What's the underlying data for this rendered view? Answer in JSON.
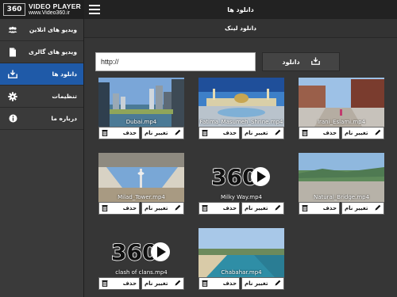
{
  "brand": {
    "logo": "360",
    "title": "VIDEO PLAYER",
    "url": "www.Video360.ir"
  },
  "sidebar": {
    "items": [
      {
        "label": "ویدیو های انلاین",
        "icon": "users-icon",
        "active": false
      },
      {
        "label": "ویدیو های گالری",
        "icon": "file-icon",
        "active": false
      },
      {
        "label": "دانلود ها",
        "icon": "download-tray-icon",
        "active": true
      },
      {
        "label": "تنظیمات",
        "icon": "gear-icon",
        "active": false
      },
      {
        "label": "درباره ما",
        "icon": "info-icon",
        "active": false
      }
    ]
  },
  "header": {
    "title": "دانلود ها",
    "menu_icon": "hamburger-icon"
  },
  "subheader": {
    "title": "دانلود لینک"
  },
  "download": {
    "url_value": "http://",
    "button_label": "دانلود",
    "button_icon": "download-tray-icon"
  },
  "actions": {
    "delete_label": "حذف",
    "rename_label": "تغییر نام",
    "delete_icon": "trash-icon",
    "rename_icon": "pencil-icon"
  },
  "videos": [
    {
      "filename": "Dubai.mp4",
      "thumb": "dubai"
    },
    {
      "filename": "Fatima_Masumeh_Shrine.mp4",
      "thumb": "shrine"
    },
    {
      "filename": "Irani_Eslami.mp4",
      "thumb": "street"
    },
    {
      "filename": "Milad_Tower.mp4",
      "thumb": "tower"
    },
    {
      "filename": "Milky Way.mp4",
      "thumb": "logo"
    },
    {
      "filename": "Natural_Bridge.mp4",
      "thumb": "bridge"
    },
    {
      "filename": "clash of clans.mp4",
      "thumb": "logo"
    },
    {
      "filename": "Chabahar.mp4",
      "thumb": "beach"
    }
  ],
  "colors": {
    "accent": "#1f5aa8",
    "sidebar_bg": "#3a3a3a",
    "topbar_bg": "#222222",
    "content_bg": "#363636"
  }
}
